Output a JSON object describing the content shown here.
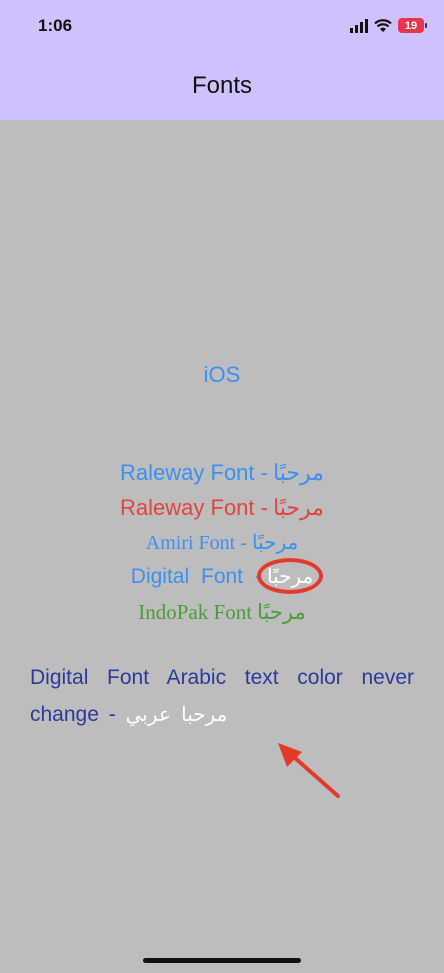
{
  "status_bar": {
    "time": "1:06",
    "battery": "19"
  },
  "nav": {
    "title": "Fonts"
  },
  "content": {
    "platform_label": "iOS",
    "lines": {
      "raleway_blue": {
        "label": "Raleway Font -",
        "arabic": "مرحبًا"
      },
      "raleway_red": {
        "label": "Raleway Font -",
        "arabic": "مرحبًا"
      },
      "amiri": {
        "label": "Amiri Font -",
        "arabic": "مرحبًا"
      },
      "digital": {
        "label": "Digital Font -",
        "arabic": "مرحبًا"
      },
      "indopak": {
        "label": "IndoPak Font",
        "arabic": "مرحبًا"
      }
    },
    "digital_note": {
      "text": "Digital Font Arabic text color never change -",
      "arabic": "مرحبا عربي"
    }
  },
  "colors": {
    "nav_bg": "#cfc2fc",
    "page_bg": "#bdbdbd",
    "blue": "#3d8ff0",
    "red": "#e0463c",
    "green": "#4a9e3a",
    "navy": "#2a3b9a",
    "annotation": "#e23b2a"
  }
}
